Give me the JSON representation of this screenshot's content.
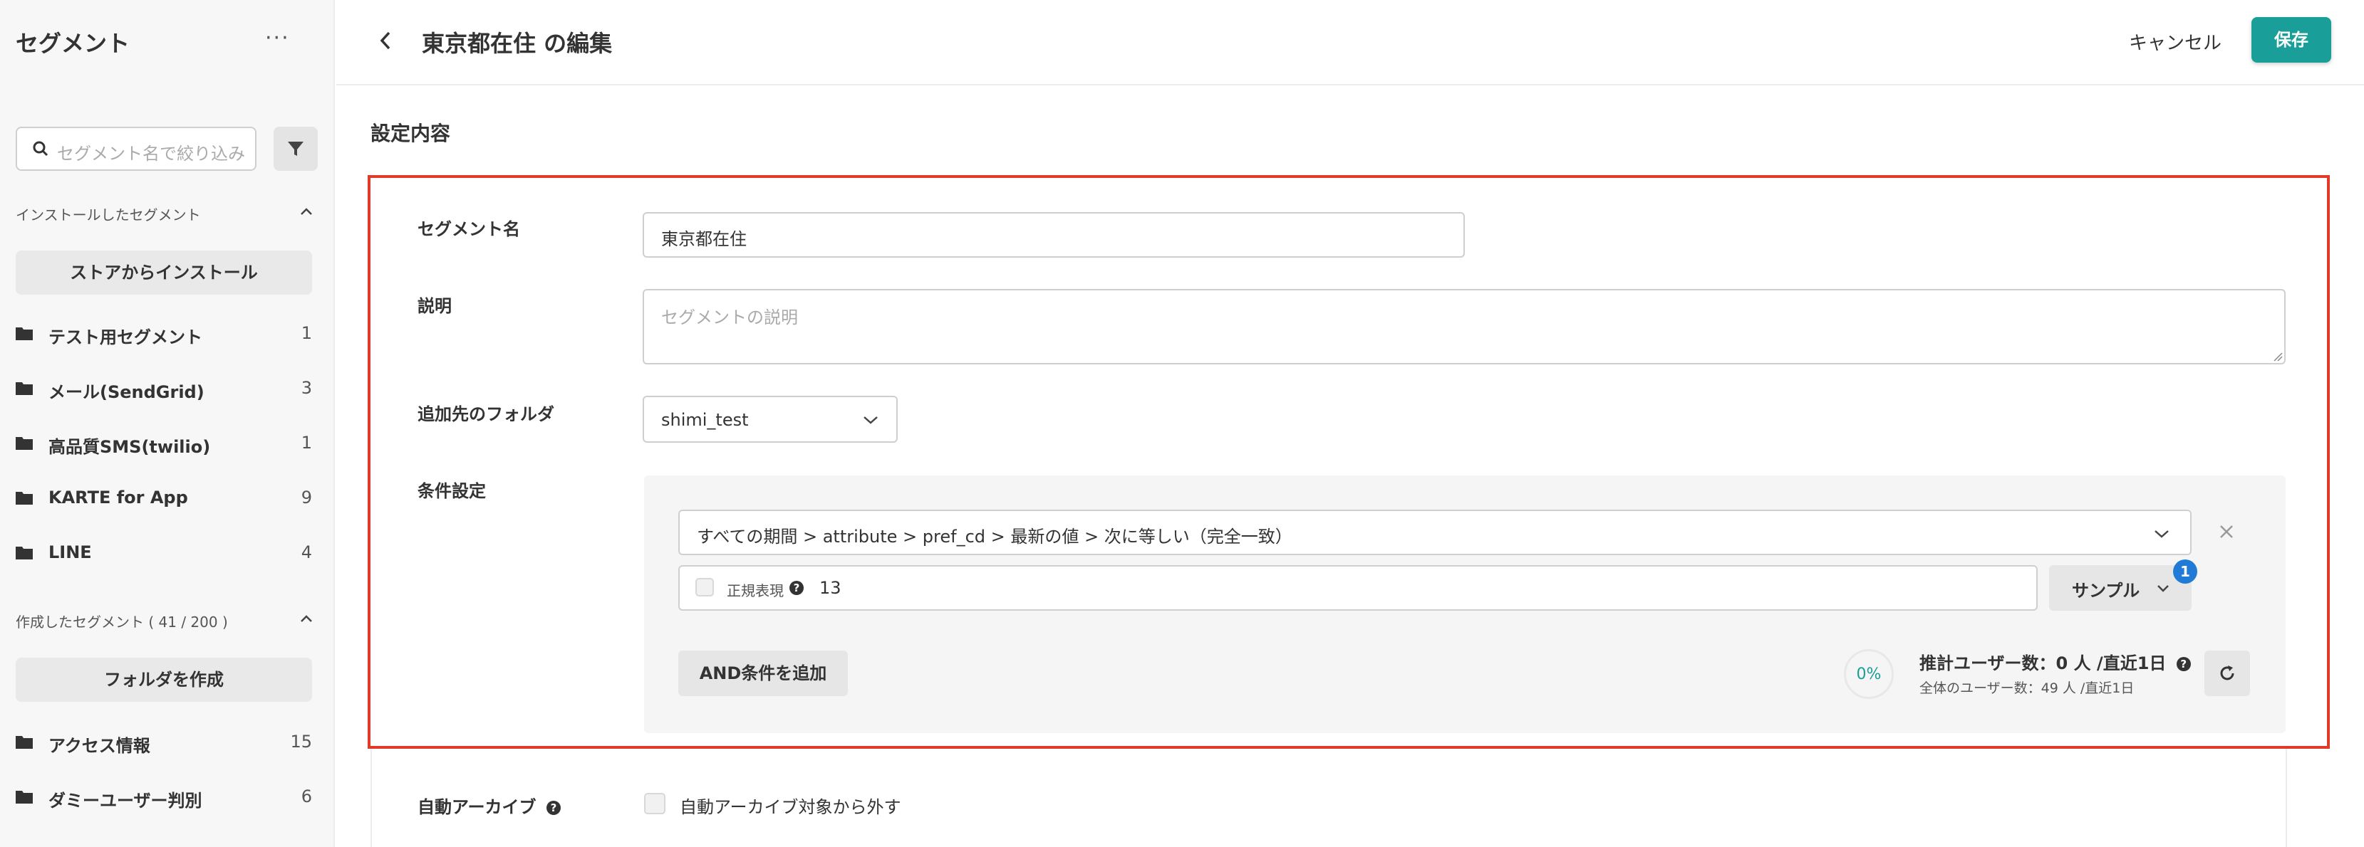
{
  "sidebar": {
    "title": "セグメント",
    "more": "···",
    "search_placeholder": "セグメント名で絞り込み",
    "installed_section": "インストールしたセグメント",
    "install_button": "ストアからインストール",
    "installed_items": [
      {
        "label": "テスト用セグメント",
        "count": "1"
      },
      {
        "label": "メール(SendGrid)",
        "count": "3"
      },
      {
        "label": "高品質SMS(twilio)",
        "count": "1"
      },
      {
        "label": "KARTE for App",
        "count": "9"
      },
      {
        "label": "LINE",
        "count": "4"
      }
    ],
    "created_section": "作成したセグメント ( 41 / 200 )",
    "create_folder_button": "フォルダを作成",
    "created_items": [
      {
        "label": "アクセス情報",
        "count": "15"
      },
      {
        "label": "ダミーユーザー判別",
        "count": "6"
      }
    ]
  },
  "header": {
    "title": "東京都在住 の編集",
    "cancel_label": "キャンセル",
    "save_label": "保存"
  },
  "settings": {
    "section_title": "設定内容",
    "name_label": "セグメント名",
    "name_value": "東京都在住",
    "description_label": "説明",
    "description_placeholder": "セグメントの説明",
    "folder_label": "追加先のフォルダ",
    "folder_value": "shimi_test",
    "condition_label": "条件設定"
  },
  "condition": {
    "rule": "すべての期間 > attribute > pref_cd > 最新の値 > 次に等しい（完全一致）",
    "regex_label": "正規表現",
    "value": "13",
    "sample_label": "サンプル",
    "sample_badge": "1",
    "and_button": "AND条件を追加",
    "percent": "0%",
    "estimate": "推計ユーザー数：0 人 /直近1日",
    "total": "全体のユーザー数：49 人 /直近1日"
  },
  "archive": {
    "label": "自動アーカイブ",
    "checkbox_label": "自動アーカイブ対象から外す"
  },
  "colors": {
    "accent": "#1a9e99",
    "highlight_border": "#e03a2a",
    "badge": "#1f7bd6"
  }
}
